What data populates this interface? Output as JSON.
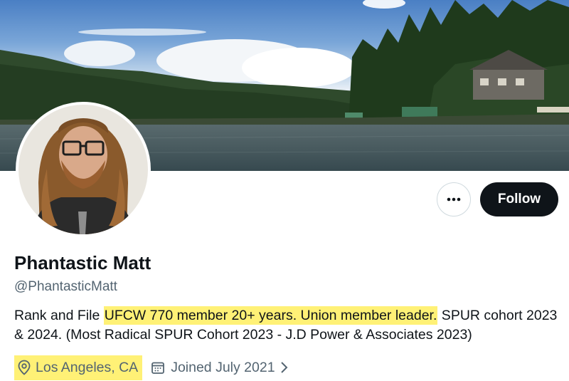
{
  "profile": {
    "display_name": "Phantastic Matt",
    "handle": "@PhantasticMatt",
    "bio": {
      "part1": "Rank and File ",
      "highlight1": "UFCW 770 member 20+ years. Union member leader.",
      "part2": " SPUR cohort 2023 & 2024. (Most Radical SPUR Cohort 2023 - J.D Power & Associates 2023)"
    },
    "location": "Los Angeles, CA",
    "joined": "Joined July 2021"
  },
  "actions": {
    "more_label": "•••",
    "follow_label": "Follow"
  },
  "icons": {
    "more": "more-horizontal-icon",
    "location": "location-pin-icon",
    "calendar": "calendar-icon",
    "chevron": "chevron-right-icon"
  },
  "colors": {
    "text_primary": "#0f1419",
    "text_secondary": "#536471",
    "highlight": "#fff176",
    "follow_bg": "#0f1419"
  }
}
